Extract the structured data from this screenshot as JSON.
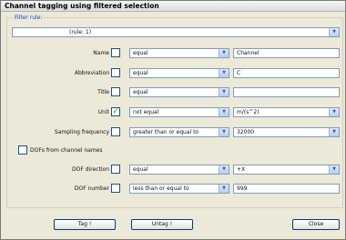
{
  "window": {
    "title": "Channel tagging using filtered selection"
  },
  "filter": {
    "legend": "Filter rule:",
    "rule_value": "(rule: 1)"
  },
  "rows": [
    {
      "label": "Name",
      "checked": false,
      "operator": "equal",
      "value": "Channel",
      "value_type": "text"
    },
    {
      "label": "Abbreviation",
      "checked": false,
      "operator": "equal",
      "value": "C",
      "value_type": "text"
    },
    {
      "label": "Title",
      "checked": false,
      "operator": "equal",
      "value": "",
      "value_type": "text"
    },
    {
      "label": "Unit",
      "checked": true,
      "operator": "not equal",
      "value": "m/(s^2)",
      "value_type": "dropdown"
    },
    {
      "label": "Sampling frequency",
      "checked": false,
      "operator": "greater than or equal to",
      "value": "32000",
      "value_type": "dropdown"
    }
  ],
  "dofs": {
    "label": "DOFs from channel names",
    "checked": false
  },
  "dof_rows": [
    {
      "label": "DOF direction",
      "checked": false,
      "operator": "equal",
      "value": "+X",
      "value_type": "dropdown"
    },
    {
      "label": "DOF number",
      "checked": false,
      "operator": "less than or equal to",
      "value": "999",
      "value_type": "text"
    }
  ],
  "buttons": {
    "tag": "Tag !",
    "untag": "Untag !",
    "close": "Close"
  },
  "icons": {
    "dropdown": "chevron-down-icon",
    "check": "checkmark-icon"
  },
  "colors": {
    "legend": "#0046d5",
    "check": "#21a121",
    "input_border": "#7f9db9"
  }
}
